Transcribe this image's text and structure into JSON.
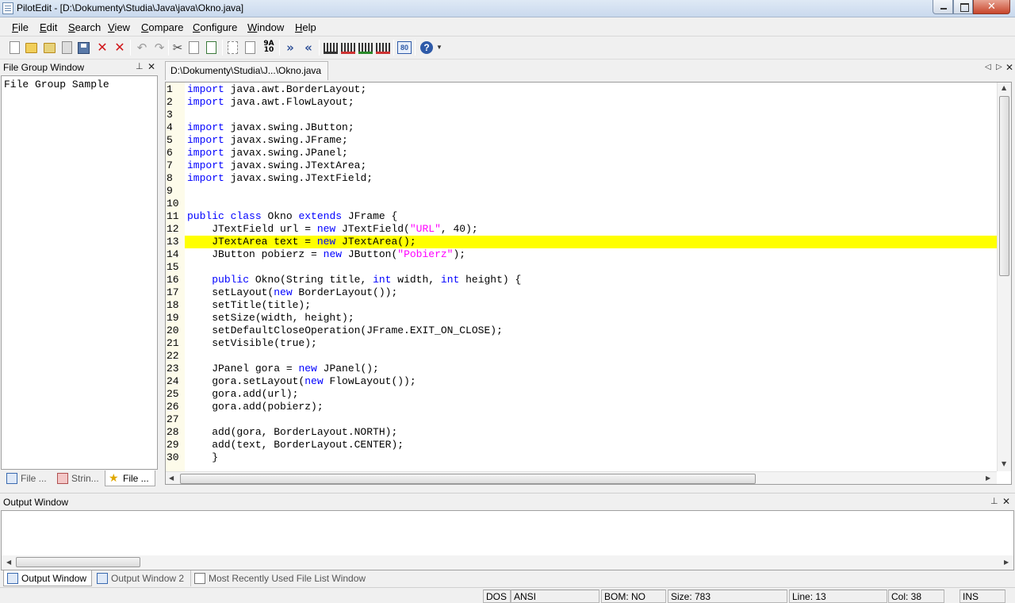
{
  "window": {
    "title": "PilotEdit - [D:\\Dokumenty\\Studia\\Java\\java\\Okno.java]"
  },
  "menu": [
    "File",
    "Edit",
    "Search",
    "View",
    "Compare",
    "Configure",
    "Window",
    "Help"
  ],
  "toolbar": {
    "icons": [
      "new-file-icon",
      "open-file-icon",
      "open-folder-icon",
      "save-icon",
      "save-all-icon",
      "close-file-icon",
      "close-all-icon",
      "undo-icon",
      "redo-icon",
      "cut-icon",
      "copy-icon",
      "paste-icon",
      "find-icon",
      "find-in-files-icon",
      "sort-icon",
      "next-tab-icon",
      "prev-tab-icon",
      "column-mode-icon",
      "record-macro-icon",
      "play-macro-icon",
      "stop-macro-icon",
      "hex-icon",
      "help-icon"
    ]
  },
  "file_group": {
    "title": "File Group Window",
    "items": [
      "File Group Sample"
    ],
    "tabs": [
      "File ...",
      "Strin...",
      "File ..."
    ]
  },
  "editor": {
    "tab_label": "D:\\Dokumenty\\Studia\\J...\\Okno.java",
    "highlighted_line": 13,
    "lines": [
      [
        {
          "t": "kw",
          "v": "import"
        },
        {
          "t": "",
          "v": " java.awt.BorderLayout;"
        }
      ],
      [
        {
          "t": "kw",
          "v": "import"
        },
        {
          "t": "",
          "v": " java.awt.FlowLayout;"
        }
      ],
      [],
      [
        {
          "t": "kw",
          "v": "import"
        },
        {
          "t": "",
          "v": " javax.swing.JButton;"
        }
      ],
      [
        {
          "t": "kw",
          "v": "import"
        },
        {
          "t": "",
          "v": " javax.swing.JFrame;"
        }
      ],
      [
        {
          "t": "kw",
          "v": "import"
        },
        {
          "t": "",
          "v": " javax.swing.JPanel;"
        }
      ],
      [
        {
          "t": "kw",
          "v": "import"
        },
        {
          "t": "",
          "v": " javax.swing.JTextArea;"
        }
      ],
      [
        {
          "t": "kw",
          "v": "import"
        },
        {
          "t": "",
          "v": " javax.swing.JTextField;"
        }
      ],
      [],
      [],
      [
        {
          "t": "kw",
          "v": "public"
        },
        {
          "t": "",
          "v": " "
        },
        {
          "t": "kw",
          "v": "class"
        },
        {
          "t": "",
          "v": " Okno "
        },
        {
          "t": "kw",
          "v": "extends"
        },
        {
          "t": "",
          "v": " JFrame {"
        }
      ],
      [
        {
          "t": "",
          "v": "    JTextField url = "
        },
        {
          "t": "kw",
          "v": "new"
        },
        {
          "t": "",
          "v": " JTextField("
        },
        {
          "t": "str",
          "v": "\"URL\""
        },
        {
          "t": "",
          "v": ", 40);"
        }
      ],
      [
        {
          "t": "",
          "v": "    JTextArea text = "
        },
        {
          "t": "kw",
          "v": "new"
        },
        {
          "t": "",
          "v": " JTextArea();"
        }
      ],
      [
        {
          "t": "",
          "v": "    JButton pobierz = "
        },
        {
          "t": "kw",
          "v": "new"
        },
        {
          "t": "",
          "v": " JButton("
        },
        {
          "t": "str",
          "v": "\"Pobierz\""
        },
        {
          "t": "",
          "v": ");"
        }
      ],
      [],
      [
        {
          "t": "",
          "v": "    "
        },
        {
          "t": "kw",
          "v": "public"
        },
        {
          "t": "",
          "v": " Okno(String title, "
        },
        {
          "t": "kw",
          "v": "int"
        },
        {
          "t": "",
          "v": " width, "
        },
        {
          "t": "kw",
          "v": "int"
        },
        {
          "t": "",
          "v": " height) {"
        }
      ],
      [
        {
          "t": "",
          "v": "    setLayout("
        },
        {
          "t": "kw",
          "v": "new"
        },
        {
          "t": "",
          "v": " BorderLayout());"
        }
      ],
      [
        {
          "t": "",
          "v": "    setTitle(title);"
        }
      ],
      [
        {
          "t": "",
          "v": "    setSize(width, height);"
        }
      ],
      [
        {
          "t": "",
          "v": "    setDefaultCloseOperation(JFrame.EXIT_ON_CLOSE);"
        }
      ],
      [
        {
          "t": "",
          "v": "    setVisible(true);"
        }
      ],
      [],
      [
        {
          "t": "",
          "v": "    JPanel gora = "
        },
        {
          "t": "kw",
          "v": "new"
        },
        {
          "t": "",
          "v": " JPanel();"
        }
      ],
      [
        {
          "t": "",
          "v": "    gora.setLayout("
        },
        {
          "t": "kw",
          "v": "new"
        },
        {
          "t": "",
          "v": " FlowLayout());"
        }
      ],
      [
        {
          "t": "",
          "v": "    gora.add(url);"
        }
      ],
      [
        {
          "t": "",
          "v": "    gora.add(pobierz);"
        }
      ],
      [],
      [
        {
          "t": "",
          "v": "    add(gora, BorderLayout.NORTH);"
        }
      ],
      [
        {
          "t": "",
          "v": "    add(text, BorderLayout.CENTER);"
        }
      ],
      [
        {
          "t": "",
          "v": "    }"
        }
      ]
    ]
  },
  "output": {
    "title": "Output Window",
    "tabs": [
      "Output Window",
      "Output Window 2",
      "Most Recently Used File List Window"
    ]
  },
  "status": {
    "line_ending": "DOS",
    "encoding": "ANSI",
    "bom": "BOM: NO",
    "size": "Size: 783",
    "line": "Line: 13",
    "col": "Col: 38",
    "mode": "INS"
  },
  "colors": {
    "keyword": "#0000ff",
    "string": "#ff00ff",
    "highlight": "#ffff00",
    "gutter": "#fdfbea"
  }
}
